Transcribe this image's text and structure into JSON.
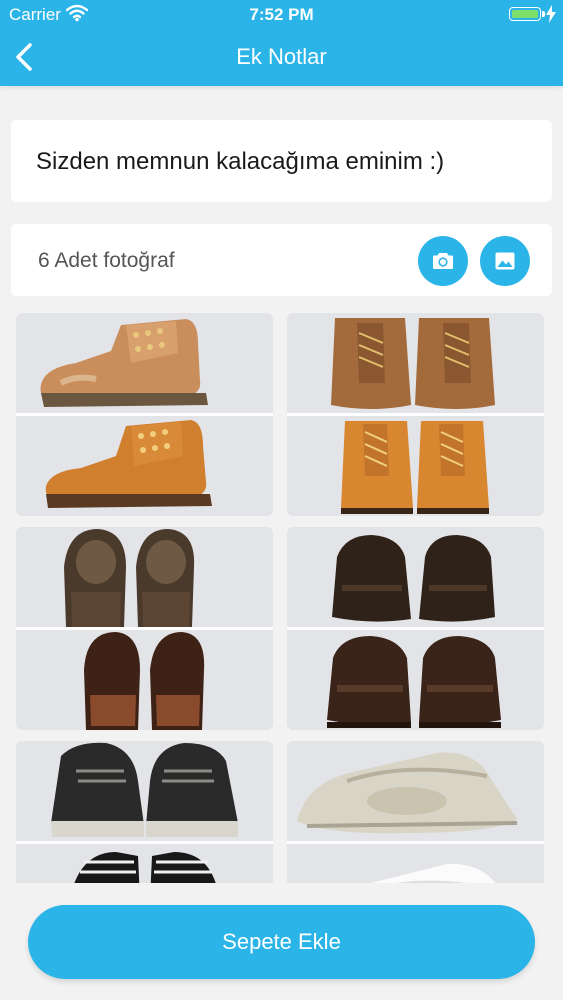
{
  "status_bar": {
    "carrier": "Carrier",
    "time": "7:52 PM"
  },
  "header": {
    "title": "Ek Notlar"
  },
  "note": {
    "text": "Sizden memnun kalacağıma eminim :)"
  },
  "photos": {
    "count_label": "6 Adet fotoğraf",
    "items": [
      {
        "subject": "tan leather boots (worn / new)"
      },
      {
        "subject": "tan leather boots front view (worn / new)"
      },
      {
        "subject": "brown shoe soles (worn / resoled)"
      },
      {
        "subject": "dark brown loafers (worn / polished)"
      },
      {
        "subject": "black and white sneakers (dirty / clean)"
      },
      {
        "subject": "white sneakers (dirty / clean)"
      }
    ]
  },
  "cta": {
    "label": "Sepete Ekle"
  },
  "colors": {
    "accent": "#2ab4e8",
    "background": "#f2f2f2",
    "card": "#ffffff"
  }
}
